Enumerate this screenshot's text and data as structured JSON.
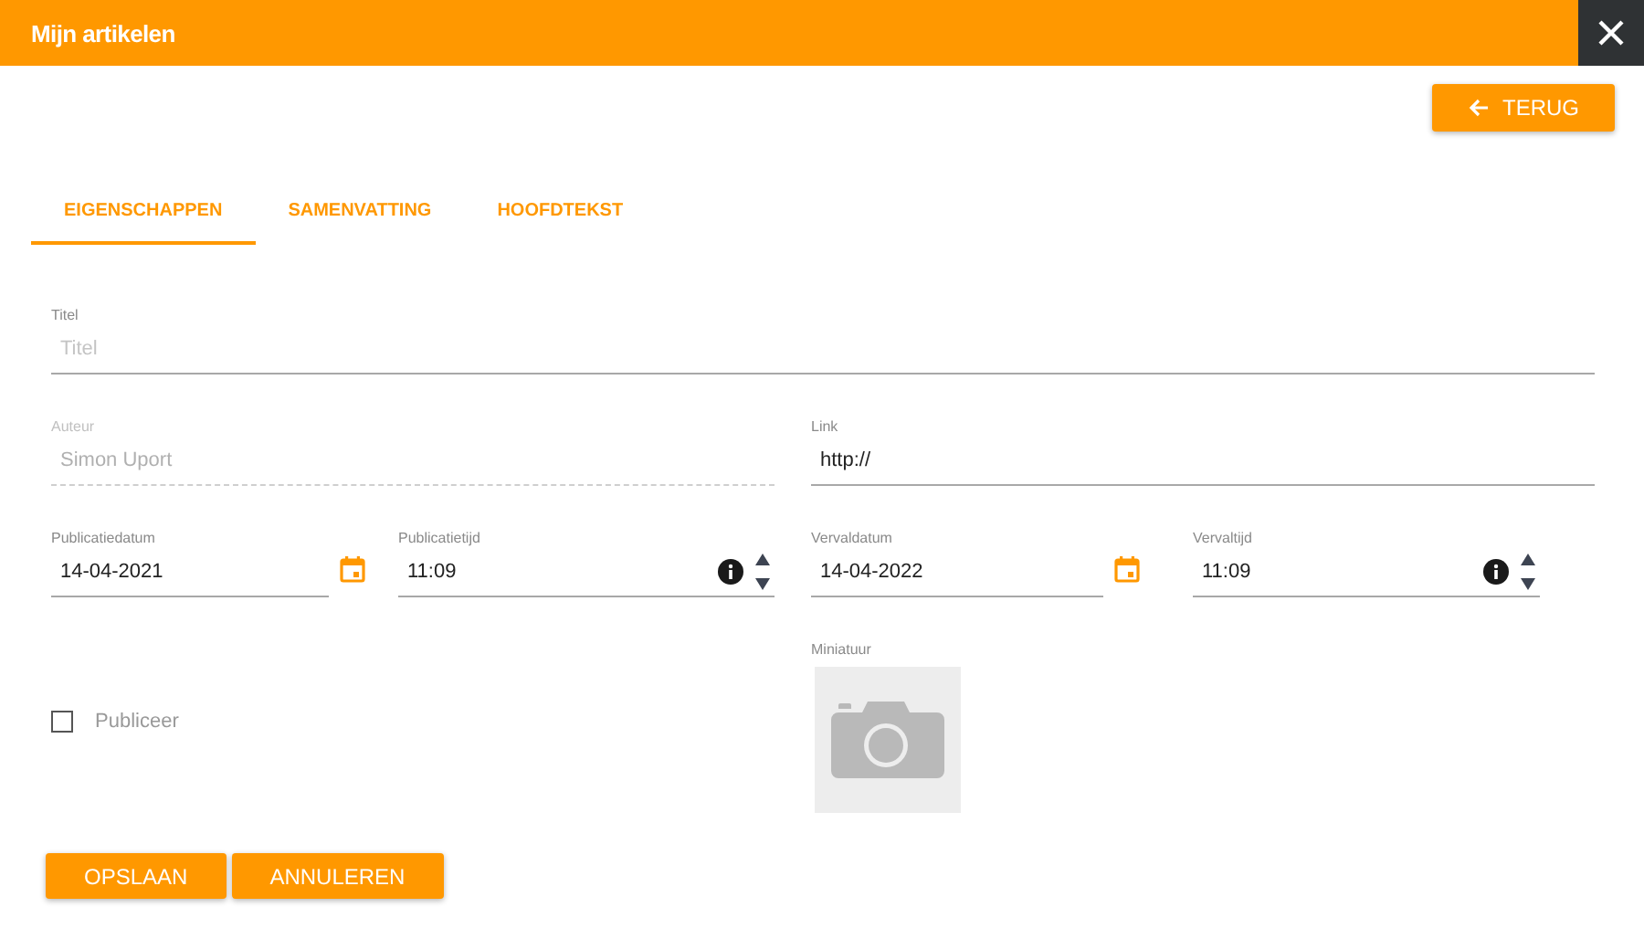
{
  "window": {
    "title": "Mijn artikelen"
  },
  "back_button": {
    "label": "TERUG"
  },
  "tabs": [
    {
      "label": "EIGENSCHAPPEN",
      "selected": true
    },
    {
      "label": "SAMENVATTING",
      "selected": false
    },
    {
      "label": "HOOFDTEKST",
      "selected": false
    }
  ],
  "title_field": {
    "label": "Titel",
    "placeholder": "Titel"
  },
  "author_field": {
    "label": "Auteur",
    "value": "Simon Uport",
    "disabled": true
  },
  "link_field": {
    "label": "Link",
    "value": "http://",
    "disabled": false
  },
  "schedule": [
    {
      "kind": "date",
      "label": "Publicatiedatum",
      "value": "14-04-2021"
    },
    {
      "kind": "time",
      "label": "Publicatietijd",
      "value": "11:09"
    },
    {
      "kind": "date",
      "label": "Vervaldatum",
      "value": "14-04-2022"
    },
    {
      "kind": "time",
      "label": "Vervaltijd",
      "value": "11:09"
    }
  ],
  "publish_checkbox": {
    "label": "Publiceer",
    "checked": false
  },
  "thumbnail": {
    "label": "Miniatuur"
  },
  "buttons": [
    "OPSLAAN",
    "ANNULEREN"
  ]
}
